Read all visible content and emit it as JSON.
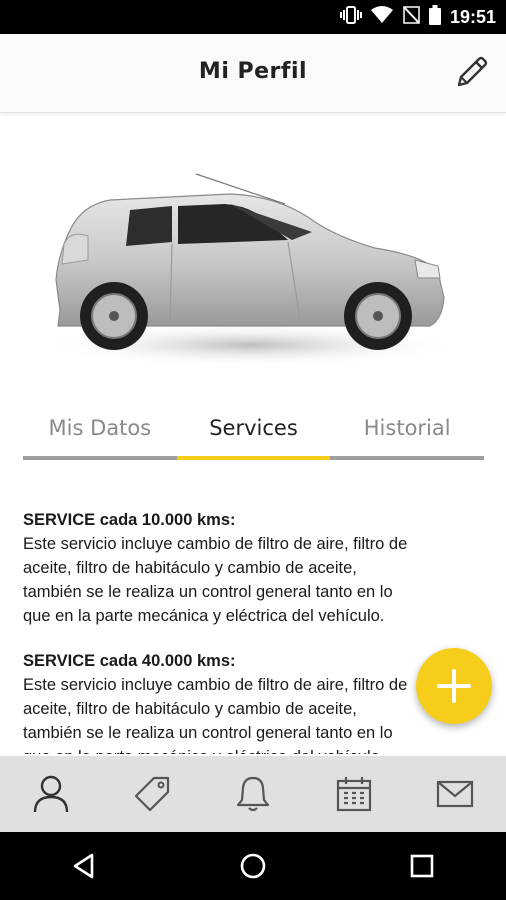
{
  "status_bar": {
    "time": "19:51",
    "icons": [
      "vibrate-icon",
      "wifi-icon",
      "no-sim-icon",
      "battery-icon"
    ]
  },
  "app_bar": {
    "title": "Mi Perfil",
    "action_icon": "edit-pencil-icon"
  },
  "tabs": [
    {
      "label": "Mis Datos",
      "active": false
    },
    {
      "label": "Services",
      "active": true
    },
    {
      "label": "Historial",
      "active": false
    }
  ],
  "services": [
    {
      "title": "SERVICE cada 10.000 kms:",
      "lines": [
        "Este servicio incluye cambio de filtro de aire, filtro de",
        "aceite, filtro de habitáculo y cambio de aceite,",
        "también se le realiza un control general tanto en lo",
        "que en la parte mecánica y eléctrica del vehículo."
      ]
    },
    {
      "title": "SERVICE cada 40.000 kms:",
      "lines": [
        "Este servicio incluye cambio de filtro de aire, filtro de",
        "aceite, filtro de habitáculo y cambio de aceite,",
        "también se le realiza un control general tanto en lo",
        "que en la parte mecánica y eléctrica del vehículo."
      ]
    }
  ],
  "fab": {
    "icon": "plus-icon"
  },
  "bottom_nav": [
    "profile-icon",
    "tag-icon",
    "bell-icon",
    "calendar-icon",
    "mail-icon"
  ],
  "system_nav": [
    "back-icon",
    "home-icon",
    "recents-icon"
  ],
  "colors": {
    "accent": "#f7cd1c",
    "tab_underline": "#9e9e9e",
    "bottom_bar": "#e0e0e0"
  }
}
